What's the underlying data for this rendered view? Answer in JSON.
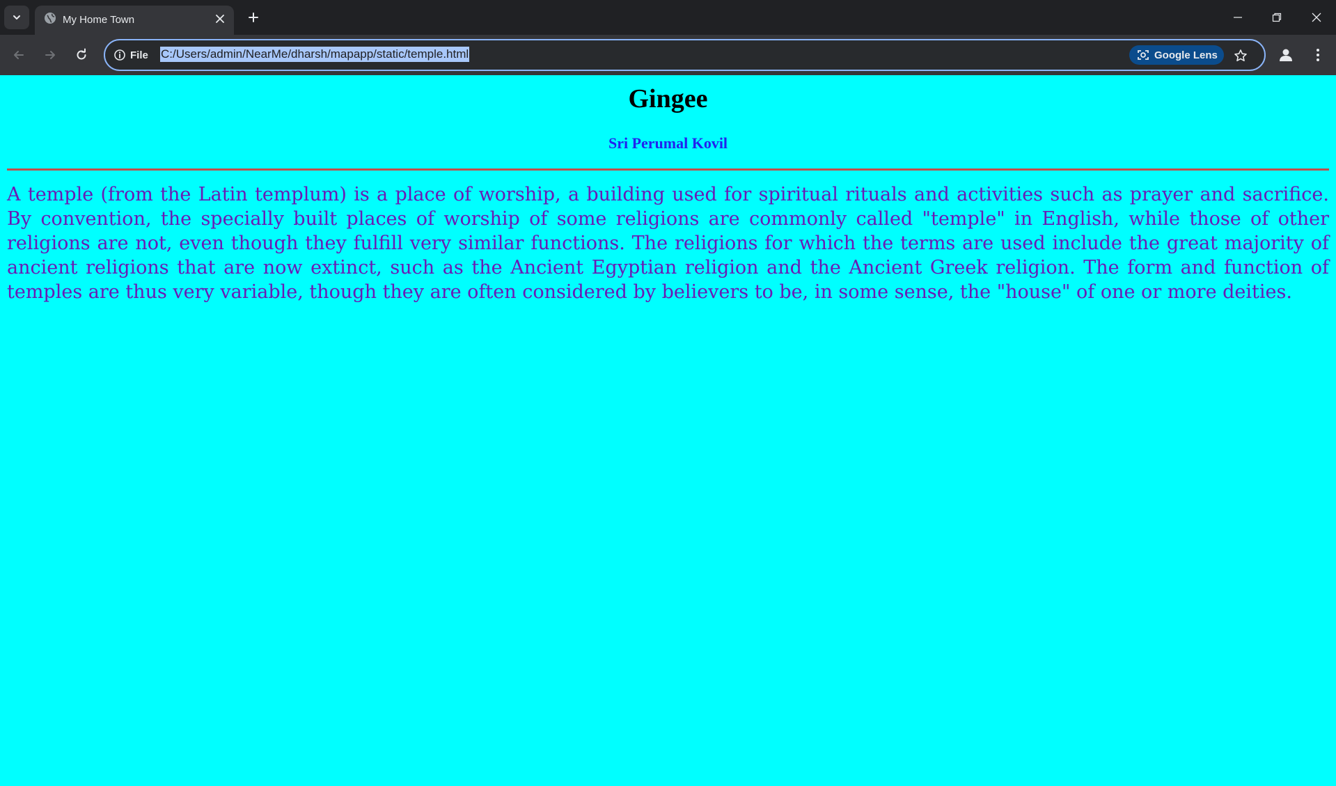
{
  "browser": {
    "tab": {
      "title": "My Home Town"
    },
    "omnibox": {
      "site_info_label": "File",
      "url": "C:/Users/admin/NearMe/dharsh/mapapp/static/temple.html",
      "lens_label": "Google Lens"
    },
    "colors": {
      "tabbar_bg": "#202124",
      "toolbar_bg": "#35363a",
      "omnibox_border": "#8ab4f8",
      "url_selection": "#a8c7fa"
    }
  },
  "page": {
    "title": "Gingee",
    "subtitle": "Sri Perumal Kovil",
    "paragraph": "A temple (from the Latin templum) is a place of worship, a building used for spiritual rituals and activities such as prayer and sacrifice. By convention, the specially built places of worship of some religions are commonly called \"temple\" in English, while those of other religions are not, even though they fulfill very similar functions. The religions for which the terms are used include the great majority of ancient religions that are now extinct, such as the Ancient Egyptian religion and the Ancient Greek religion. The form and function of temples are thus very variable, though they are often considered by believers to be, in some sense, the \"house\" of one or more deities.",
    "colors": {
      "background": "#00ffff",
      "title": "#000000",
      "subtitle": "#2222ee",
      "divider": "#c0504d",
      "paragraph": "#6a1bb5"
    }
  }
}
